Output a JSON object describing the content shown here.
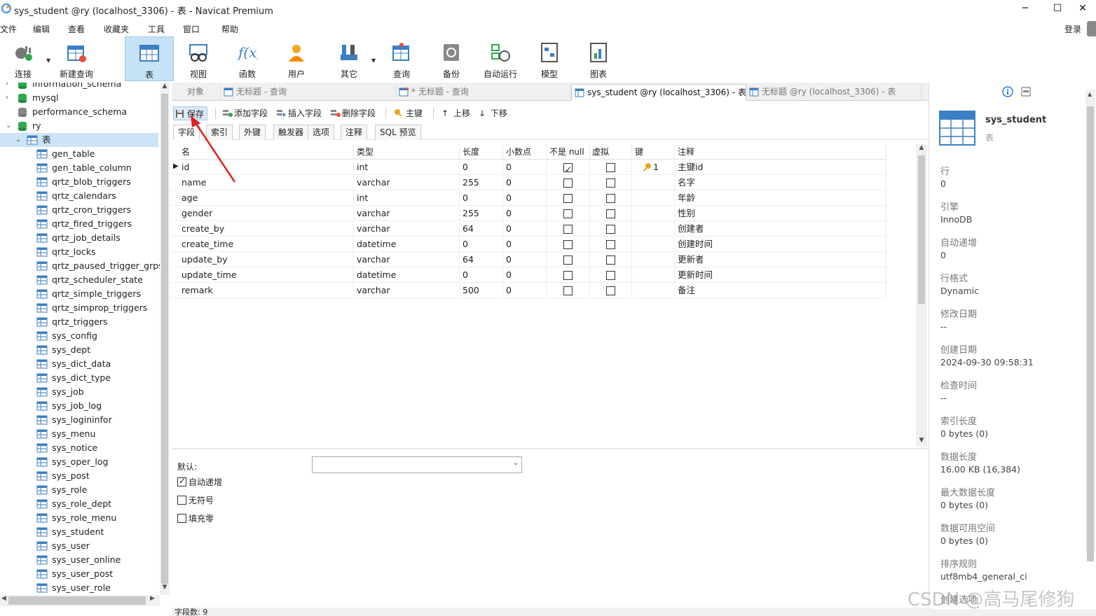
{
  "window": {
    "title": "sys_student @ry (localhost_3306) - 表 - Navicat Premium",
    "login": "登录"
  },
  "menu": [
    "文件",
    "编辑",
    "查看",
    "收藏夹",
    "工具",
    "窗口",
    "帮助"
  ],
  "toolbar": [
    "连接",
    "新建查询",
    "表",
    "视图",
    "函数",
    "用户",
    "其它",
    "查询",
    "备份",
    "自动运行",
    "模型",
    "图表"
  ],
  "sidebar": {
    "databases": [
      "information_schema",
      "mysql",
      "performance_schema",
      "ry"
    ],
    "tables_node": "表",
    "tables": [
      "gen_table",
      "gen_table_column",
      "qrtz_blob_triggers",
      "qrtz_calendars",
      "qrtz_cron_triggers",
      "qrtz_fired_triggers",
      "qrtz_job_details",
      "qrtz_locks",
      "qrtz_paused_trigger_grps",
      "qrtz_scheduler_state",
      "qrtz_simple_triggers",
      "qrtz_simprop_triggers",
      "qrtz_triggers",
      "sys_config",
      "sys_dept",
      "sys_dict_data",
      "sys_dict_type",
      "sys_job",
      "sys_job_log",
      "sys_logininfor",
      "sys_menu",
      "sys_notice",
      "sys_oper_log",
      "sys_post",
      "sys_role",
      "sys_role_dept",
      "sys_role_menu",
      "sys_student",
      "sys_user",
      "sys_user_online",
      "sys_user_post",
      "sys_user_role"
    ]
  },
  "tabs": [
    "对象",
    "无标题 - 查询",
    "* 无标题 - 查询",
    "sys_student @ry (localhost_3306) - 表",
    "无标题 @ry (localhost_3306) - 表"
  ],
  "editor_toolbar": {
    "save": "保存",
    "add_field": "添加字段",
    "insert_field": "插入字段",
    "delete_field": "删除字段",
    "primary_key": "主键",
    "move_up": "上移",
    "move_down": "下移"
  },
  "subtabs": [
    "字段",
    "索引",
    "外键",
    "触发器",
    "选项",
    "注释",
    "SQL 预览"
  ],
  "columns": [
    "名",
    "类型",
    "长度",
    "小数点",
    "不是 null",
    "虚拟",
    "键",
    "注释"
  ],
  "rows": [
    {
      "name": "id",
      "type": "int",
      "length": "0",
      "decimals": "0",
      "not_null": true,
      "virtual": false,
      "key": "1",
      "comment": "主键id"
    },
    {
      "name": "name",
      "type": "varchar",
      "length": "255",
      "decimals": "0",
      "not_null": false,
      "virtual": false,
      "key": "",
      "comment": "名字"
    },
    {
      "name": "age",
      "type": "int",
      "length": "0",
      "decimals": "0",
      "not_null": false,
      "virtual": false,
      "key": "",
      "comment": "年龄"
    },
    {
      "name": "gender",
      "type": "varchar",
      "length": "255",
      "decimals": "0",
      "not_null": false,
      "virtual": false,
      "key": "",
      "comment": "性别"
    },
    {
      "name": "create_by",
      "type": "varchar",
      "length": "64",
      "decimals": "0",
      "not_null": false,
      "virtual": false,
      "key": "",
      "comment": "创建者"
    },
    {
      "name": "create_time",
      "type": "datetime",
      "length": "0",
      "decimals": "0",
      "not_null": false,
      "virtual": false,
      "key": "",
      "comment": "创建时间"
    },
    {
      "name": "update_by",
      "type": "varchar",
      "length": "64",
      "decimals": "0",
      "not_null": false,
      "virtual": false,
      "key": "",
      "comment": "更新者"
    },
    {
      "name": "update_time",
      "type": "datetime",
      "length": "0",
      "decimals": "0",
      "not_null": false,
      "virtual": false,
      "key": "",
      "comment": "更新时间"
    },
    {
      "name": "remark",
      "type": "varchar",
      "length": "500",
      "decimals": "0",
      "not_null": false,
      "virtual": false,
      "key": "",
      "comment": "备注"
    }
  ],
  "field_props": {
    "default_label": "默认:",
    "auto_increment": {
      "label": "自动递增",
      "checked": true
    },
    "unsigned": {
      "label": "无符号",
      "checked": false
    },
    "zerofill": {
      "label": "填充零",
      "checked": false
    }
  },
  "status": {
    "field_count": "字段数: 9"
  },
  "info_panel": {
    "table_name": "sys_student",
    "table_type": "表",
    "props": [
      {
        "label": "行",
        "value": "0"
      },
      {
        "label": "引擎",
        "value": "InnoDB"
      },
      {
        "label": "自动递增",
        "value": "0"
      },
      {
        "label": "行格式",
        "value": "Dynamic"
      },
      {
        "label": "修改日期",
        "value": "--"
      },
      {
        "label": "创建日期",
        "value": "2024-09-30 09:58:31"
      },
      {
        "label": "检查时间",
        "value": "--"
      },
      {
        "label": "索引长度",
        "value": "0 bytes (0)"
      },
      {
        "label": "数据长度",
        "value": "16.00 KB (16,384)"
      },
      {
        "label": "最大数据长度",
        "value": "0 bytes (0)"
      },
      {
        "label": "数据可用空间",
        "value": "0 bytes (0)"
      },
      {
        "label": "排序规则",
        "value": "utf8mb4_general_ci"
      },
      {
        "label": "创建选项",
        "value": ""
      }
    ]
  },
  "watermark": "CSDN @高马尾修狗",
  "colors": {
    "selection": "#cce4f7",
    "toolbar_selected": "#c6e2f6",
    "annotation_arrow": "#e02020",
    "db_icon_green": "#2fa84f",
    "table_icon_blue": "#3b7fc4"
  }
}
